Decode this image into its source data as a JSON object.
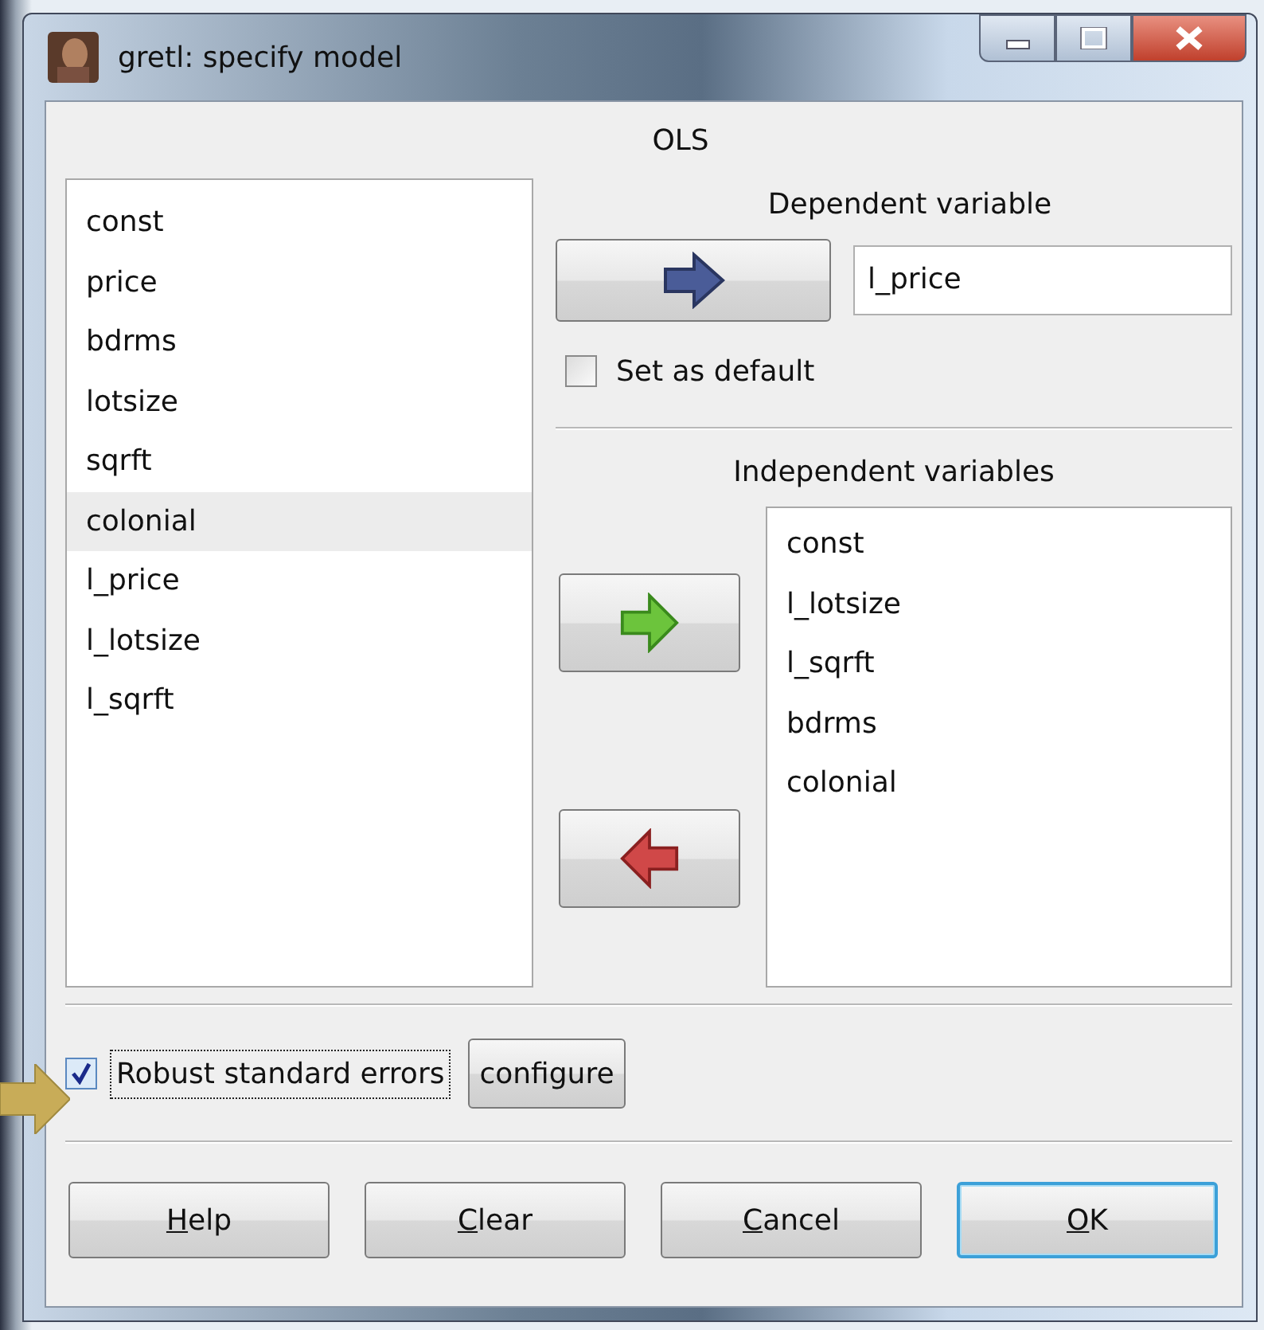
{
  "window": {
    "title": "gretl: specify model"
  },
  "estimator": "OLS",
  "variables": [
    {
      "name": "const",
      "selected": false
    },
    {
      "name": "price",
      "selected": false
    },
    {
      "name": "bdrms",
      "selected": false
    },
    {
      "name": "lotsize",
      "selected": false
    },
    {
      "name": "sqrft",
      "selected": false
    },
    {
      "name": "colonial",
      "selected": true
    },
    {
      "name": "l_price",
      "selected": false
    },
    {
      "name": "l_lotsize",
      "selected": false
    },
    {
      "name": "l_sqrft",
      "selected": false
    }
  ],
  "dependent": {
    "label": "Dependent variable",
    "value": "l_price",
    "set_as_default": {
      "label": "Set as default",
      "checked": false
    }
  },
  "independent": {
    "label": "Independent variables",
    "items": [
      "const",
      "l_lotsize",
      "l_sqrft",
      "bdrms",
      "colonial"
    ]
  },
  "robust": {
    "label": "Robust standard errors",
    "checked": true,
    "focused": true
  },
  "configure_button": "configure",
  "buttons": [
    {
      "mnemonic": "H",
      "rest": "elp",
      "default": false
    },
    {
      "mnemonic": "C",
      "rest": "lear",
      "default": false
    },
    {
      "mnemonic": "C",
      "rest": "ancel",
      "default": false
    },
    {
      "mnemonic": "O",
      "rest": "K",
      "default": true
    }
  ]
}
